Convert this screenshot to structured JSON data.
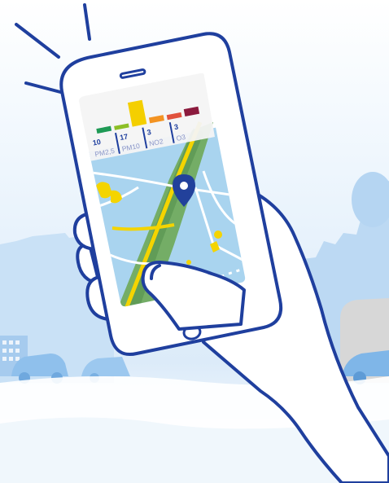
{
  "colors": {
    "outline": "#1f3f9e",
    "sky_top": "#ffffff",
    "sky_mid": "#e3f0fb",
    "city": "#b9d8f3",
    "city_dark": "#9cc4ea",
    "gray_bldg": "#d9d9d9",
    "map_water": "#a9d4ef",
    "map_green": "#7db06b",
    "map_green_dark": "#4e8c49",
    "map_yellow": "#f4d400",
    "map_road": "#ffffff",
    "pin": "#22419b",
    "hand": "#ffffff"
  },
  "levels": [
    {
      "name": "good",
      "color": "#1f9a55",
      "height": 6
    },
    {
      "name": "fair",
      "color": "#8cbf26",
      "height": 5
    },
    {
      "name": "moderate",
      "color": "#f4cf00",
      "height": 30
    },
    {
      "name": "poor",
      "color": "#f39322",
      "height": 7
    },
    {
      "name": "very-poor",
      "color": "#e1523d",
      "height": 6
    },
    {
      "name": "extremely-poor",
      "color": "#8b1a3d",
      "height": 9
    }
  ],
  "pollutants": [
    {
      "value": "10",
      "label": "PM2,5"
    },
    {
      "value": "17",
      "label": "PM10"
    },
    {
      "value": "3",
      "label": "NO2"
    },
    {
      "value": "3",
      "label": "O3"
    }
  ],
  "icons": [
    "location-pin-icon"
  ]
}
